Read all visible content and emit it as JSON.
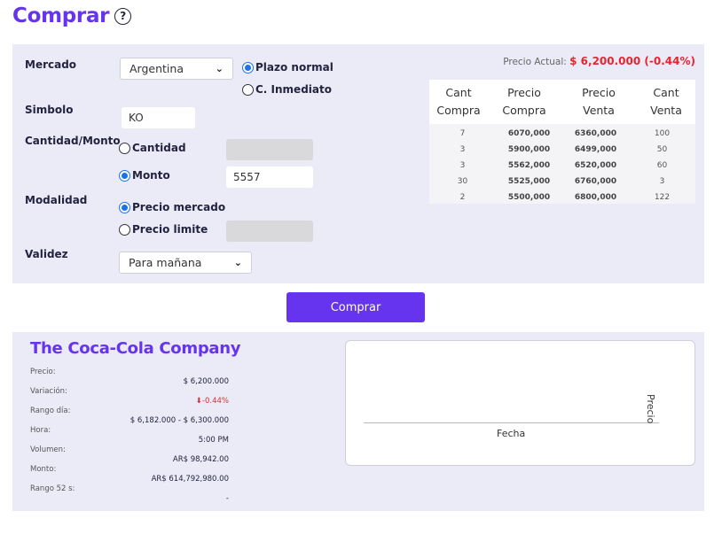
{
  "header": {
    "title": "Comprar",
    "help_icon": "question-circle-icon"
  },
  "form": {
    "mercado": {
      "label": "Mercado",
      "value": "Argentina"
    },
    "plazo_options": [
      {
        "label": "Plazo normal",
        "selected": true
      },
      {
        "label": "C. Inmediato",
        "selected": false
      }
    ],
    "simbolo": {
      "label": "Simbolo",
      "value": "KO"
    },
    "cantidad_monto": {
      "label": "Cantidad/Monto",
      "cantidad_label": "Cantidad",
      "monto_label": "Monto",
      "cantidad_value": "",
      "monto_value": "5557",
      "selected": "Monto"
    },
    "modalidad": {
      "label": "Modalidad",
      "options": [
        {
          "label": "Precio mercado",
          "selected": true
        },
        {
          "label": "Precio limite",
          "selected": false
        }
      ],
      "limit_value": ""
    },
    "validez": {
      "label": "Validez",
      "value": "Para mañana"
    },
    "precio_actual": {
      "label": "Precio Actual:",
      "value": "$ 6,200.000 (-0.44%)"
    }
  },
  "order_book": {
    "headers": [
      "Cant Compra",
      "Precio Compra",
      "Precio Venta",
      "Cant Venta"
    ],
    "rows": [
      [
        "7",
        "6070,000",
        "6360,000",
        "100"
      ],
      [
        "3",
        "5900,000",
        "6499,000",
        "50"
      ],
      [
        "3",
        "5562,000",
        "6520,000",
        "60"
      ],
      [
        "30",
        "5525,000",
        "6760,000",
        "3"
      ],
      [
        "2",
        "5500,000",
        "6800,000",
        "122"
      ]
    ]
  },
  "buy_button": {
    "label": "Comprar"
  },
  "company": {
    "name": "The Coca-Cola Company",
    "labels": [
      "Precio:",
      "Variación:",
      "Rango día:",
      "Hora:",
      "Volumen:",
      "Monto:",
      "Rango 52 s:"
    ],
    "values": {
      "precio": "$ 6,200.000",
      "variacion": "-0.44%",
      "rango_dia": "$ 6,182.000 - $ 6,300.000",
      "hora": "5:00 PM",
      "volumen": "AR$ 98,942.00",
      "monto": "AR$ 614,792,980.00",
      "rango_52": "-"
    },
    "colors": {
      "accent": "#6633ee",
      "negative": "#e8252e"
    }
  },
  "chart": {
    "xlabel": "Fecha",
    "ylabel": "Precio"
  }
}
